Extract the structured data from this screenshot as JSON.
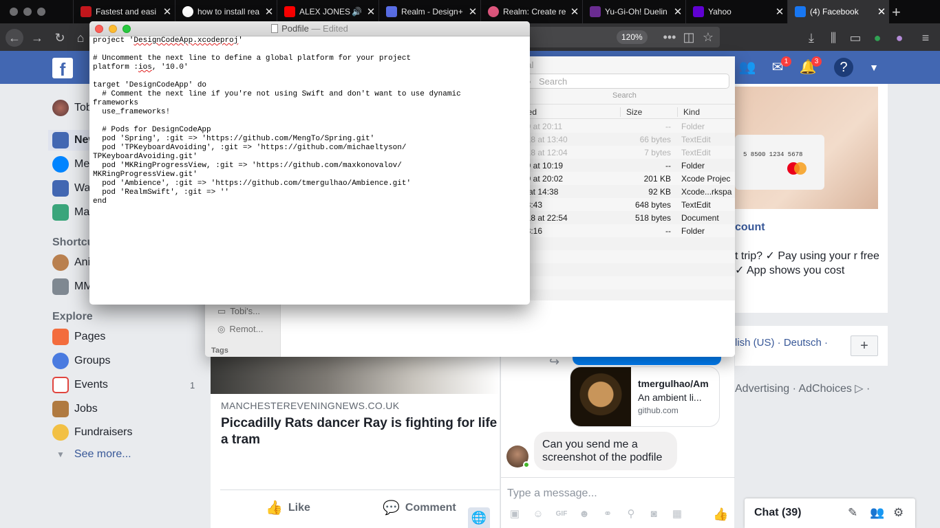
{
  "browser": {
    "tabs": [
      {
        "title": "Fastest and easi",
        "fav_color": "#c4171d"
      },
      {
        "title": "how to install rea",
        "fav_color": "#ffffff"
      },
      {
        "title": "ALEX JONES",
        "fav_color": "#ff0000"
      },
      {
        "title": "Realm - Design+",
        "fav_color": "#5a6fe8"
      },
      {
        "title": "Realm: Create re",
        "fav_color": "#e0587f"
      },
      {
        "title": "Yu-Gi-Oh! Duelin",
        "fav_color": "#6a2c91"
      },
      {
        "title": "Yahoo",
        "fav_color": "#6001d2"
      },
      {
        "title": "(4) Facebook",
        "fav_color": "#1877f2"
      }
    ],
    "zoom": "120%"
  },
  "facebook": {
    "messenger_badge": "1",
    "notif_badge": "3",
    "left_nav": {
      "user": "Tob",
      "items": [
        "New",
        "Me",
        "Wa",
        "Ma"
      ],
      "shortcuts_heading": "Shortcu",
      "shortcuts": [
        "Ani",
        "MM"
      ],
      "explore_heading": "Explore",
      "explore": [
        {
          "label": "Pages",
          "count": ""
        },
        {
          "label": "Groups",
          "count": ""
        },
        {
          "label": "Events",
          "count": "1"
        },
        {
          "label": "Jobs",
          "count": ""
        },
        {
          "label": "Fundraisers",
          "count": ""
        }
      ],
      "see_more": "See more..."
    },
    "post": {
      "source": "MANCHESTEREVENINGNEWS.CO.UK",
      "title": "Piccadilly Rats dancer Ray is fighting for life a tram",
      "like": "Like",
      "comment": "Comment"
    },
    "ad": {
      "card_number": "5 8500 1234 5678",
      "link": "count",
      "text": "t trip? ✓ Pay using your r free ✓ App shows you cost"
    },
    "languages": "lish (US) · Deutsch ·",
    "plus": "+",
    "footer": "Advertising · AdChoices ▷ ·",
    "messenger": {
      "preview_title": "tmergulhao/Am",
      "preview_sub": "An ambient li...",
      "preview_url": "github.com",
      "message": "Can you send me a screenshot of the podfile",
      "input_placeholder": "Type a message..."
    },
    "chat": {
      "label": "Chat (39)"
    }
  },
  "finder": {
    "title": "nal",
    "search_placeholder": "Search",
    "search_label": "Search",
    "columns": {
      "modified": "ified",
      "size": "Size",
      "kind": "Kind"
    },
    "rows": [
      {
        "date": "19 at 20:11",
        "size": "--",
        "kind": "Folder",
        "dim": true
      },
      {
        "date": "018 at 13:40",
        "size": "66 bytes",
        "kind": "TextEdit",
        "dim": true
      },
      {
        "date": "018 at 12:04",
        "size": "7 bytes",
        "kind": "TextEdit",
        "dim": true
      },
      {
        "date": "19 at 10:19",
        "size": "--",
        "kind": "Folder",
        "dim": false
      },
      {
        "date": "19 at 20:02",
        "size": "201 KB",
        "kind": "Xcode Projec",
        "dim": false
      },
      {
        "date": "8 at 14:38",
        "size": "92 KB",
        "kind": "Xcode...rkspa",
        "dim": false
      },
      {
        "date": "08:43",
        "size": "648 bytes",
        "kind": "TextEdit",
        "dim": false
      },
      {
        "date": "018 at 22:54",
        "size": "518 bytes",
        "kind": "Document",
        "dim": false
      },
      {
        "date": "08:16",
        "size": "--",
        "kind": "Folder",
        "dim": false
      }
    ],
    "sidebar": {
      "items": [
        "Tobi's...",
        "Remot..."
      ],
      "tags": "Tags"
    }
  },
  "textedit": {
    "filename": "Podfile",
    "status": "— Edited",
    "line1_pre": "project '",
    "line1_sq": "DesignCodeApp.xcodeproj",
    "line1_post": "'",
    "line3": "# Uncomment the next line to define a global platform for your project",
    "line4_pre": "platform :",
    "line4_sq": "ios",
    "line4_post": ", '10.0'",
    "rest": "target 'DesignCodeApp' do\n  # Comment the next line if you're not using Swift and don't want to use dynamic\nframeworks\n  use_frameworks!\n\n  # Pods for DesignCodeApp\n  pod 'Spring', :git => 'https://github.com/MengTo/Spring.git'\n  pod 'TPKeyboardAvoiding', :git => 'https://github.com/michaeltyson/\nTPKeyboardAvoiding.git'\n  pod 'MKRingProgressView, :git => 'https://github.com/maxkonovalov/\nMKRingProgressView.git'\n  pod 'Ambience', :git => 'https://github.com/tmergulhao/Ambience.git'\n  pod 'RealmSwift', :git => ''\nend"
  }
}
